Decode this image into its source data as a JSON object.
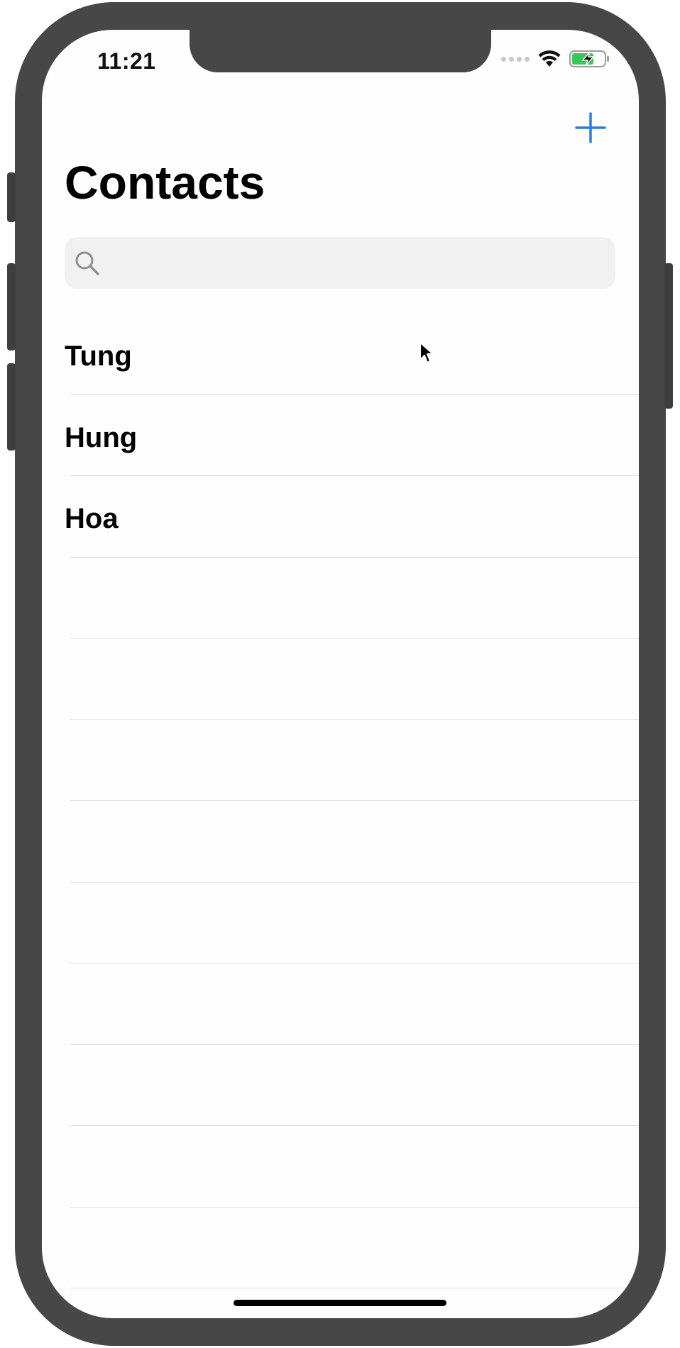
{
  "status_bar": {
    "time": "11:21",
    "icons": [
      "cellular-signal-icon",
      "wifi-icon",
      "battery-charging-icon"
    ],
    "battery_color": "#34c759"
  },
  "nav_bar": {
    "add_icon": "plus-icon",
    "accent_color": "#2b7de1"
  },
  "header": {
    "title": "Contacts"
  },
  "search": {
    "icon": "search-icon",
    "value": "",
    "placeholder": ""
  },
  "contacts": [
    {
      "name": "Tung"
    },
    {
      "name": "Hung"
    },
    {
      "name": "Hoa"
    }
  ],
  "empty_rows": 10
}
